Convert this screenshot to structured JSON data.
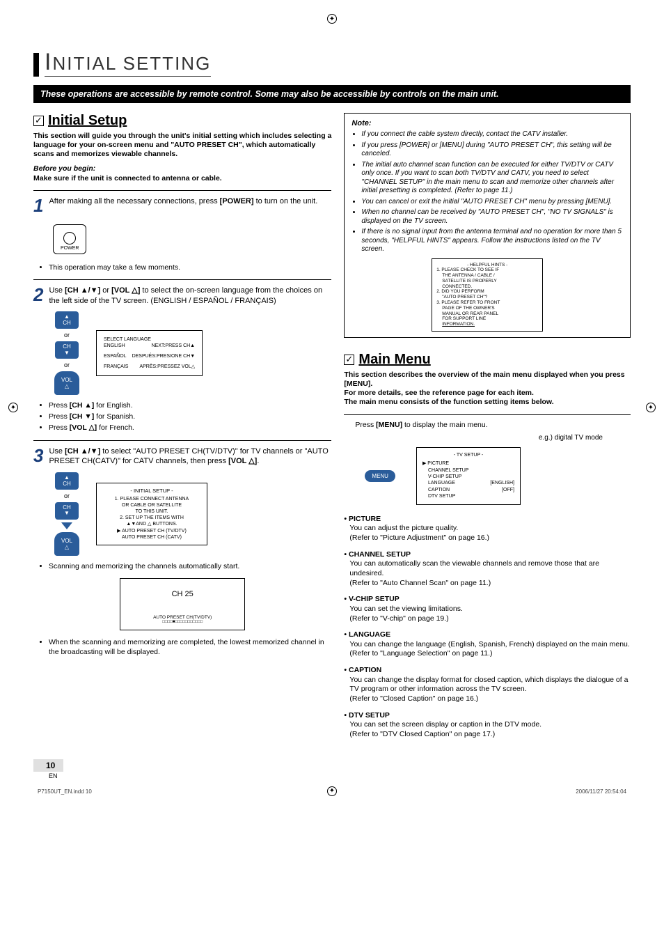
{
  "header": {
    "title_big_letter": "I",
    "title_rest": "NITIAL SETTING"
  },
  "banner": "These operations are accessible by remote control. Some may also be accessible by controls on the main unit.",
  "initial_setup": {
    "heading": "Initial Setup",
    "intro": "This section will guide you through the unit's initial setting which includes selecting a language for your on-screen menu and \"AUTO PRESET CH\", which automatically scans and memorizes viewable channels.",
    "before_label": "Before you begin:",
    "before_text": "Make sure if the unit is connected to antenna or cable.",
    "step1": {
      "num": "1",
      "text_a": "After making all the necessary connections, press ",
      "text_b": "[POWER]",
      "text_c": " to turn on the unit.",
      "power_label": "POWER",
      "bullet": "This operation may take a few moments."
    },
    "step2": {
      "num": "2",
      "text_a": "Use ",
      "text_b": "[CH ▲/▼]",
      "text_c": " or ",
      "text_d": "[VOL △]",
      "text_e": " to select the on-screen language from the choices on the left side of the TV screen. (ENGLISH / ESPAÑOL / FRANÇAIS)",
      "ch_up": "▲\nCH",
      "or": "or",
      "ch_dn": "CH\n▼",
      "vol": "VOL △",
      "osd_title": "SELECT LANGUAGE",
      "osd_rows": [
        {
          "l": "ENGLISH",
          "r": "NEXT:PRESS CH▲"
        },
        {
          "l": "ESPAÑOL",
          "r": "DESPUÉS:PRESIONE CH▼"
        },
        {
          "l": "FRANÇAIS",
          "r": "APRÈS:PRESSEZ VOL△"
        }
      ],
      "bullets": {
        "b1a": "Press ",
        "b1b": "[CH ▲]",
        "b1c": " for English.",
        "b2a": "Press ",
        "b2b": "[CH ▼]",
        "b2c": " for Spanish.",
        "b3a": "Press ",
        "b3b": "[VOL △]",
        "b3c": " for French."
      }
    },
    "step3": {
      "num": "3",
      "text_a": "Use ",
      "text_b": "[CH ▲/▼]",
      "text_c": " to select \"AUTO PRESET CH(TV/DTV)\" for TV channels or \"AUTO PRESET CH(CATV)\" for CATV channels, then press ",
      "text_d": "[VOL △]",
      "text_e": ".",
      "box_title": "- INITIAL SETUP -",
      "box_l1": "1. PLEASE CONNECT ANTENNA",
      "box_l2": "OR CABLE OR SATELLITE",
      "box_l3": "TO THIS UNIT.",
      "box_l4": "2. SET UP THE ITEMS WITH",
      "box_l5": "▲▼AND △ BUTTONS.",
      "box_l6": "▶ AUTO PRESET CH (TV/DTV)",
      "box_l7": "AUTO PRESET CH (CATV)",
      "bullet1": "Scanning and memorizing the channels automatically start.",
      "scan_ch": "CH  25",
      "scan_label": "AUTO PRESET CH(TV/DTV)",
      "scan_bar": "□□□□■□□□□□□□□□□□",
      "bullet2": "When the scanning and memorizing are completed, the lowest memorized channel in the broadcasting will be displayed."
    }
  },
  "note": {
    "title": "Note:",
    "items": [
      "If you connect the cable system directly, contact the CATV installer.",
      "If you press [POWER] or [MENU] during \"AUTO PRESET CH\", this setting will be canceled.",
      "The initial auto channel scan function can be executed for either TV/DTV or CATV only once. If you want to scan both TV/DTV and CATV, you need to select \"CHANNEL SETUP\" in the main menu to scan and memorize other channels after initial presetting is completed. (Refer to page 11.)",
      "You can cancel or exit the initial \"AUTO PRESET CH\" menu by pressing [MENU].",
      "When no channel can be received by \"AUTO PRESET CH\", \"NO TV SIGNALS\" is displayed on the TV screen.",
      "If there is no signal input from the antenna terminal and no operation for more than 5 seconds, \"HELPFUL HINTS\" appears. Follow the instructions listed on the TV screen."
    ],
    "hints": {
      "title": "- HELPFUL HINTS -",
      "l1": "1. PLEASE CHECK TO SEE IF",
      "l2": "THE ANTENNA / CABLE /",
      "l3": "SATELLITE IS PROPERLY",
      "l4": "CONNECTED.",
      "l5": "2. DID YOU PERFORM",
      "l6": "\"AUTO PRESET CH\"?",
      "l7": "3. PLEASE REFER TO FRONT",
      "l8": "PAGE OF THE OWNER'S",
      "l9": "MANUAL OR REAR PANEL",
      "l10": "FOR SUPPORT LINE",
      "l11": "INFORMATION."
    }
  },
  "main_menu": {
    "heading": "Main Menu",
    "intro1": "This section describes the overview of the main menu displayed when you press [MENU].",
    "intro2": "For more details, see the reference page for each item.",
    "intro3": "The main menu consists of the function setting items below.",
    "press_a": "Press ",
    "press_b": "[MENU]",
    "press_c": " to display the main menu.",
    "menu_btn": "MENU",
    "eg": "e.g.) digital TV mode",
    "tvsetup": {
      "title": "-  TV SETUP  -",
      "rows": [
        {
          "l": "▶ PICTURE",
          "r": ""
        },
        {
          "l": "CHANNEL SETUP",
          "r": ""
        },
        {
          "l": "V-CHIP  SETUP",
          "r": ""
        },
        {
          "l": "LANGUAGE",
          "r": "[ENGLISH]"
        },
        {
          "l": "CAPTION",
          "r": "[OFF]"
        },
        {
          "l": "DTV SETUP",
          "r": ""
        }
      ]
    },
    "settings": [
      {
        "hd": "• PICTURE",
        "b1": "You can adjust the picture quality.",
        "b2": "(Refer to \"Picture Adjustment\" on page 16.)"
      },
      {
        "hd": "• CHANNEL SETUP",
        "b1": "You can automatically scan the viewable channels and remove those that are undesired.",
        "b2": "(Refer to \"Auto Channel Scan\" on page 11.)"
      },
      {
        "hd": "• V-CHIP SETUP",
        "b1": "You can set the viewing limitations.",
        "b2": "(Refer to \"V-chip\" on page 19.)"
      },
      {
        "hd": "• LANGUAGE",
        "b1": "You can change the language (English, Spanish, French) displayed on the main menu.",
        "b2": "(Refer to \"Language Selection\" on page 11.)"
      },
      {
        "hd": "• CAPTION",
        "b1": "You can change the display format for closed caption, which displays the dialogue of a TV program or other information across the TV screen.",
        "b2": "(Refer to \"Closed Caption\" on page 16.)"
      },
      {
        "hd": "• DTV SETUP",
        "b1": "You can set the screen display or caption in the DTV mode.",
        "b2": "(Refer to \"DTV Closed Caption\" on page 17.)"
      }
    ]
  },
  "page": {
    "num": "10",
    "en": "EN"
  },
  "footer": {
    "file": "P7150UT_EN.indd   10",
    "date": "2006/11/27   20:54:04"
  }
}
